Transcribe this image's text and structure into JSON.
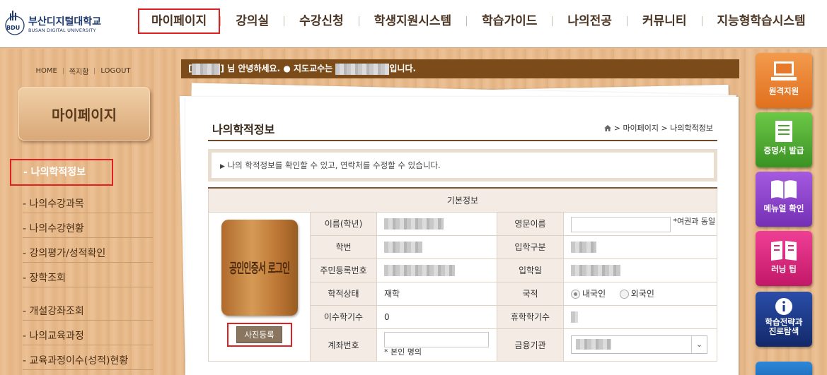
{
  "header": {
    "logo_name": "부산디지털대학교",
    "logo_eng": "BUSAN DIGITAL UNIVERSITY",
    "logo_mark": "BDU",
    "nav": [
      "마이페이지",
      "강의실",
      "수강신청",
      "학생지원시스템",
      "학습가이드",
      "나의전공",
      "커뮤니티",
      "지능형학습시스템"
    ]
  },
  "sidebar": {
    "util": [
      "HOME",
      "쪽지함",
      "LOGOUT"
    ],
    "title": "마이페이지",
    "items": [
      "- 나의학적정보",
      "- 나의수강과목",
      "- 나의수강현황",
      "- 강의평가/성적확인",
      "- 장학조회",
      "- 개설강좌조회",
      "- 나의교육과정",
      "- 교육과정이수(성적)현황"
    ]
  },
  "welcome": {
    "open_bracket": "[",
    "greeting": "] 님 안녕하세요.",
    "bullet": "●",
    "advisor_label": "지도교수는",
    "suffix": "입니다."
  },
  "page": {
    "title": "나의학적정보",
    "breadcrumb": [
      "마이페이지",
      "나의학적정보"
    ],
    "breadcrumb_sep": ">",
    "notice": "나의 학적정보를 확인할 수 있고, 연락처를 수정할 수 있습니다."
  },
  "table": {
    "section": "기본정보",
    "cert_text": "공인인증서 로그인",
    "photo_button": "사진등록",
    "labels": {
      "name": "이름(학년)",
      "eng_name": "영문이름",
      "student_no": "학번",
      "admission_type": "입학구분",
      "resident_no": "주민등록번호",
      "admission_date": "입학일",
      "status": "학적상태",
      "nationality": "국적",
      "credits": "이수학기수",
      "leave_credits": "휴학학기수",
      "account": "계좌번호",
      "bank": "금융기관"
    },
    "values": {
      "status": "재학",
      "credits": "0"
    },
    "eng_name_note": "*여권과 동일",
    "nationality_options": [
      "내국인",
      "외국인"
    ],
    "nationality_selected": "내국인",
    "account_note": "* 본인 명의"
  },
  "quick_menu": [
    {
      "label": "원격지원",
      "color": "#e8792a",
      "icon": "laptop-icon"
    },
    {
      "label": "증명서 발급",
      "color": "#4aa42e",
      "icon": "document-icon"
    },
    {
      "label": "메뉴얼 확인",
      "color": "#8a3fc8",
      "icon": "book-icon"
    },
    {
      "label": "러닝 팁",
      "color": "#d8247a",
      "icon": "open-book-icon"
    },
    {
      "label": "학습전략과 진로탐색",
      "color": "#1a3a8a",
      "icon": "info-icon"
    }
  ]
}
